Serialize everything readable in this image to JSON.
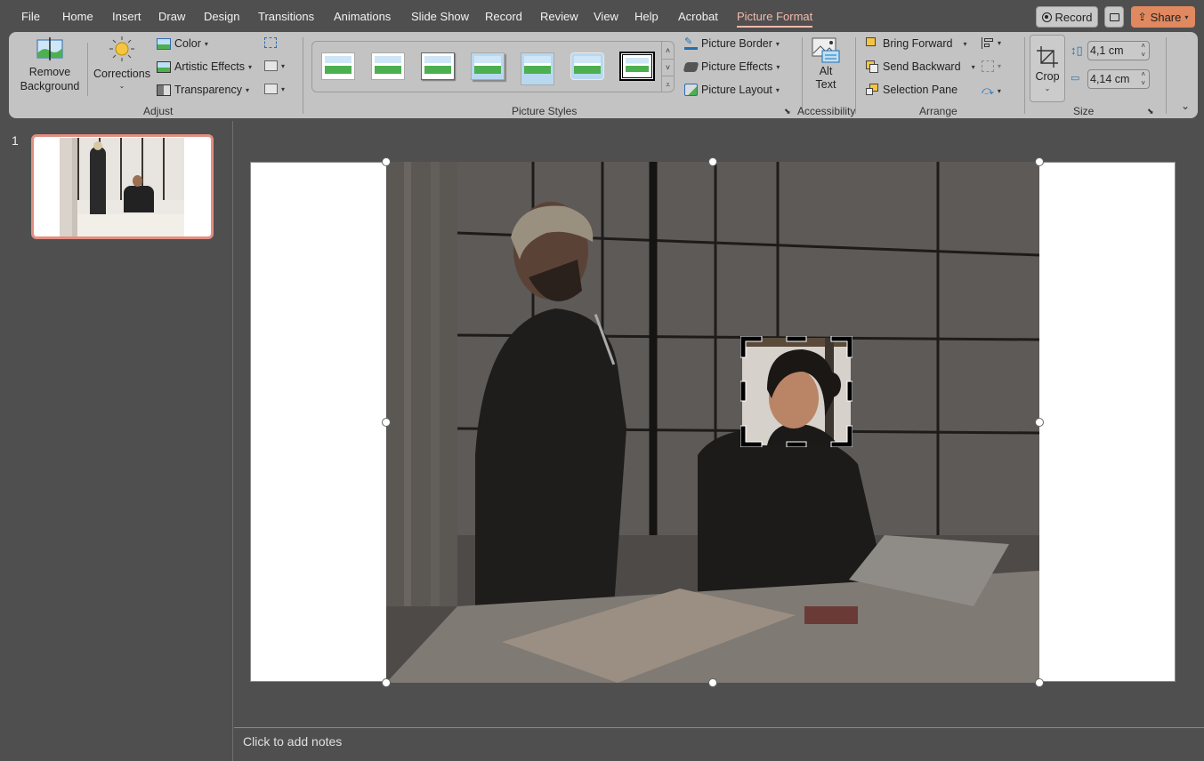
{
  "menu": {
    "tabs": [
      {
        "label": "File",
        "active": false
      },
      {
        "label": "Home",
        "active": false
      },
      {
        "label": "Insert",
        "active": false
      },
      {
        "label": "Draw",
        "active": false
      },
      {
        "label": "Design",
        "active": false
      },
      {
        "label": "Transitions",
        "active": false
      },
      {
        "label": "Animations",
        "active": false
      },
      {
        "label": "Slide Show",
        "active": false
      },
      {
        "label": "Record",
        "active": false
      },
      {
        "label": "Review",
        "active": false
      },
      {
        "label": "View",
        "active": false
      },
      {
        "label": "Help",
        "active": false
      },
      {
        "label": "Acrobat",
        "active": false
      },
      {
        "label": "Picture Format",
        "active": true
      }
    ],
    "record_button": "Record",
    "share_button": "Share",
    "comment_icon": "comment-icon"
  },
  "ribbon": {
    "adjust": {
      "label": "Adjust",
      "remove_background": [
        "Remove",
        "Background"
      ],
      "corrections": "Corrections",
      "color": "Color",
      "artistic_effects": "Artistic Effects",
      "transparency": "Transparency"
    },
    "picture_styles": {
      "label": "Picture Styles",
      "gallery_count": 7,
      "picture_border": "Picture Border",
      "picture_effects": "Picture Effects",
      "picture_layout": "Picture Layout"
    },
    "accessibility": {
      "label": "Accessibility",
      "alt_text": [
        "Alt",
        "Text"
      ]
    },
    "arrange": {
      "label": "Arrange",
      "bring_forward": "Bring Forward",
      "send_backward": "Send Backward",
      "selection_pane": "Selection Pane"
    },
    "size": {
      "label": "Size",
      "crop": "Crop",
      "height": "4,1 cm",
      "width": "4,14 cm"
    }
  },
  "slides": [
    {
      "number": "1",
      "selected": true
    }
  ],
  "notes_placeholder": "Click to add notes",
  "colors": {
    "accent": "#f4b9ac",
    "share": "#e0885f",
    "slide_selected_border": "#e28f82",
    "ribbon_bg": "#c3c3c3",
    "app_bg": "#4f4f4f"
  }
}
